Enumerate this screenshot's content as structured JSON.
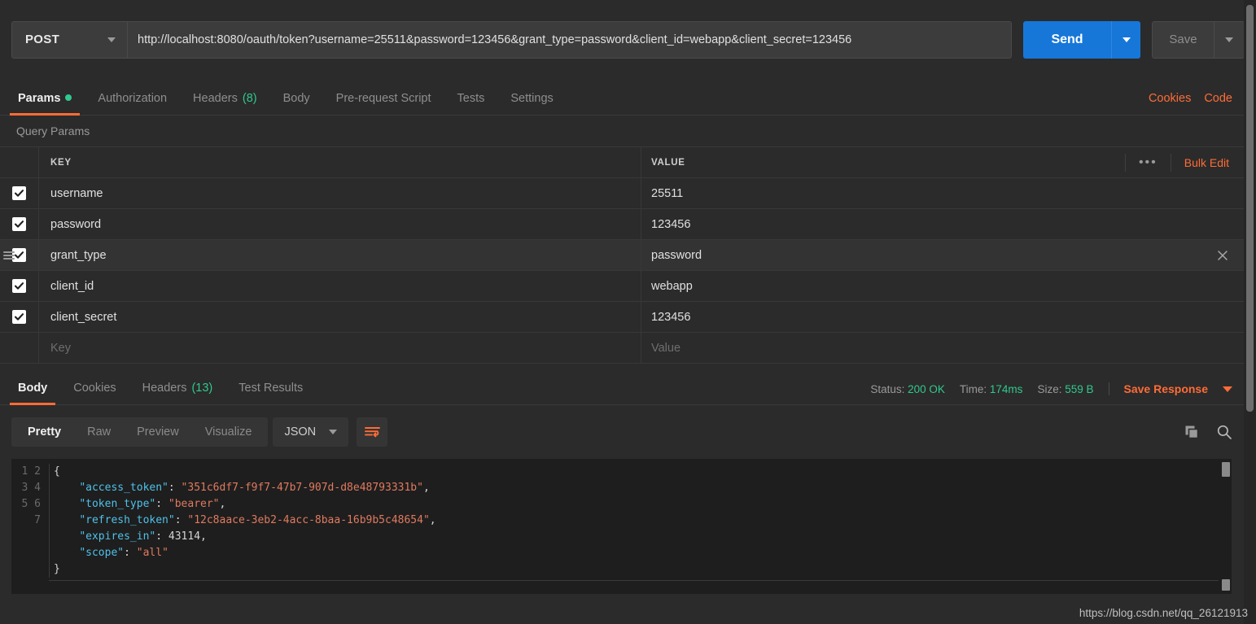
{
  "request": {
    "method": "POST",
    "url": "http://localhost:8080/oauth/token?username=25511&password=123456&grant_type=password&client_id=webapp&client_secret=123456",
    "send_label": "Send",
    "save_label": "Save"
  },
  "request_tabs": {
    "items": [
      {
        "label": "Params",
        "badge": "",
        "dot": true,
        "active": true
      },
      {
        "label": "Authorization",
        "badge": "",
        "dot": false,
        "active": false
      },
      {
        "label": "Headers",
        "badge": "(8)",
        "dot": false,
        "active": false
      },
      {
        "label": "Body",
        "badge": "",
        "dot": false,
        "active": false
      },
      {
        "label": "Pre-request Script",
        "badge": "",
        "dot": false,
        "active": false
      },
      {
        "label": "Tests",
        "badge": "",
        "dot": false,
        "active": false
      },
      {
        "label": "Settings",
        "badge": "",
        "dot": false,
        "active": false
      }
    ],
    "cookies_label": "Cookies",
    "code_label": "Code"
  },
  "query_params": {
    "section_title": "Query Params",
    "columns": {
      "key": "KEY",
      "value": "VALUE"
    },
    "bulk_edit_label": "Bulk Edit",
    "dots_label": "•••",
    "rows": [
      {
        "checked": true,
        "key": "username",
        "value": "25511",
        "hovered": false
      },
      {
        "checked": true,
        "key": "password",
        "value": "123456",
        "hovered": false
      },
      {
        "checked": true,
        "key": "grant_type",
        "value": "password",
        "hovered": true
      },
      {
        "checked": true,
        "key": "client_id",
        "value": "webapp",
        "hovered": false
      },
      {
        "checked": true,
        "key": "client_secret",
        "value": "123456",
        "hovered": false
      }
    ],
    "empty_row": {
      "key_placeholder": "Key",
      "value_placeholder": "Value"
    }
  },
  "response_tabs": {
    "items": [
      {
        "label": "Body",
        "badge": "",
        "active": true
      },
      {
        "label": "Cookies",
        "badge": "",
        "active": false
      },
      {
        "label": "Headers",
        "badge": "(13)",
        "active": false
      },
      {
        "label": "Test Results",
        "badge": "",
        "active": false
      }
    ],
    "status_key": "Status:",
    "status_value": "200 OK",
    "time_key": "Time:",
    "time_value": "174ms",
    "size_key": "Size:",
    "size_value": "559 B",
    "save_response_label": "Save Response"
  },
  "body_toolbar": {
    "views": [
      {
        "label": "Pretty",
        "active": true
      },
      {
        "label": "Raw",
        "active": false
      },
      {
        "label": "Preview",
        "active": false
      },
      {
        "label": "Visualize",
        "active": false
      }
    ],
    "format": "JSON",
    "wrap_icon": "word-wrap-icon",
    "copy_icon": "copy-icon",
    "search_icon": "search-icon"
  },
  "response_body": {
    "line_numbers": [
      "1",
      "2",
      "3",
      "4",
      "5",
      "6",
      "7"
    ],
    "json": {
      "access_token": "351c6df7-f9f7-47b7-907d-d8e48793331b",
      "token_type": "bearer",
      "refresh_token": "12c8aace-3eb2-4acc-8baa-16b9b5c48654",
      "expires_in": "43114",
      "scope": "all"
    },
    "raw_lines": [
      "{",
      "    \"access_token\": \"351c6df7-f9f7-47b7-907d-d8e48793331b\",",
      "    \"token_type\": \"bearer\",",
      "    \"refresh_token\": \"12c8aace-3eb2-4acc-8baa-16b9b5c48654\",",
      "    \"expires_in\": 43114,",
      "    \"scope\": \"all\"",
      "}"
    ]
  },
  "watermark": "https://blog.csdn.net/qq_26121913",
  "colors": {
    "accent": "#ff6c37",
    "send_blue": "#1677d9",
    "success_green": "#30c98d",
    "bg": "#2b2b2b",
    "code_bg": "#1e1e1e",
    "json_key": "#4fc1e9",
    "json_string": "#e07a5f"
  }
}
